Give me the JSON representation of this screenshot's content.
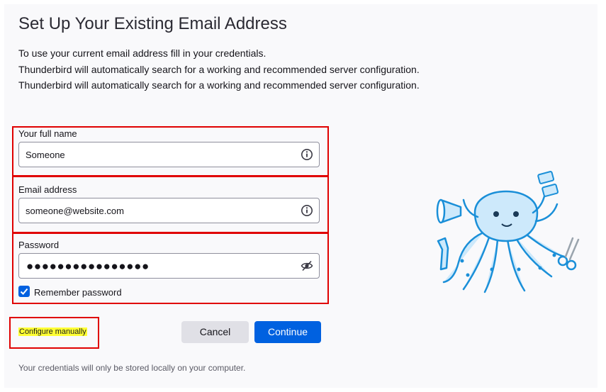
{
  "window": {
    "title": "Set Up Your Existing Email Address"
  },
  "intro": [
    "To use your current email address fill in your credentials.",
    "Thunderbird will automatically search for a working and recommended server configuration.",
    "Thunderbird will automatically search for a working and recommended server configuration."
  ],
  "form": {
    "name_label": "Your full name",
    "name_value": "Someone",
    "email_label": "Email address",
    "email_value": "someone@website.com",
    "password_label": "Password",
    "password_value": "●●●●●●●●●●●●●●●●",
    "remember_label": "Remember password",
    "remember_checked": true
  },
  "actions": {
    "configure_manually": "Configure manually",
    "cancel": "Cancel",
    "continue": "Continue"
  },
  "footer": "Your credentials will only be stored locally on your computer.",
  "icons": {
    "info": "info-icon",
    "eye": "eye-slash-icon",
    "mascot": "octopus-mascot"
  },
  "colors": {
    "accent": "#0061e0",
    "highlight": "#ffff33",
    "annotation": "#e00000"
  }
}
